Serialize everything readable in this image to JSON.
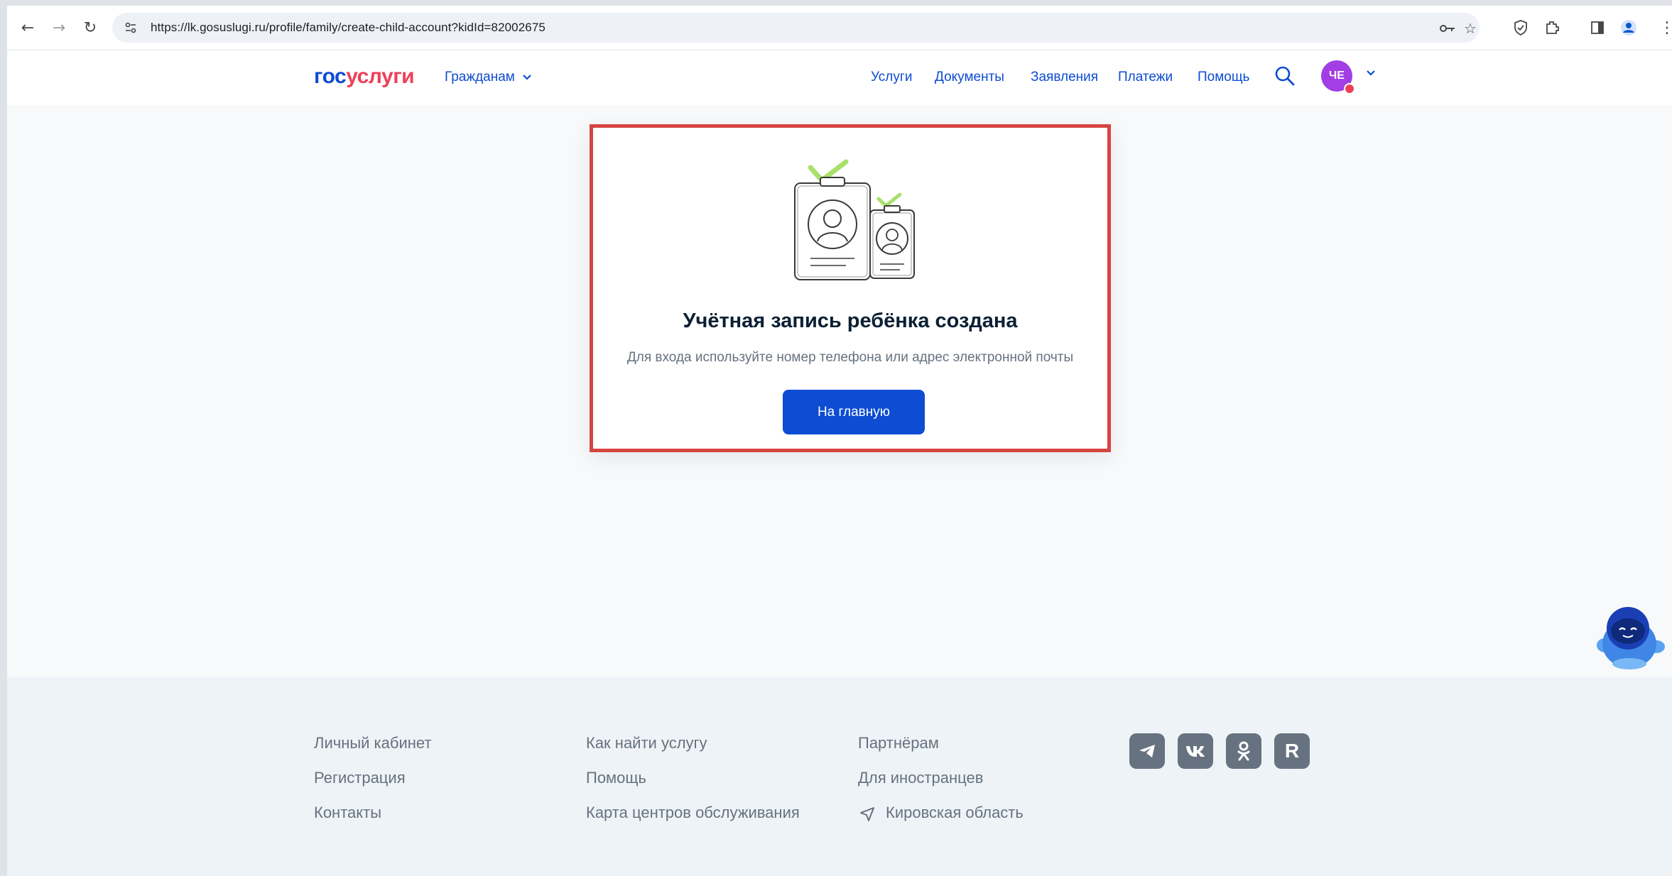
{
  "browser": {
    "url": "https://lk.gosuslugi.ru/profile/family/create-child-account?kidId=82002675",
    "icons": [
      "back-arrow-icon",
      "forward-arrow-icon",
      "reload-icon",
      "site-info-icon",
      "key-icon",
      "star-icon",
      "shield-icon",
      "extensions-icon",
      "sidepanel-icon",
      "profile-icon",
      "menu-icon"
    ]
  },
  "header": {
    "logo_part1": "гос",
    "logo_part2": "услуги",
    "citizens_label": "Гражданам",
    "nav": [
      "Услуги",
      "Документы",
      "Заявления",
      "Платежи",
      "Помощь"
    ],
    "avatar_initials": "ЧЕ"
  },
  "card": {
    "title": "Учётная запись ребёнка создана",
    "subtitle": "Для входа используйте номер телефона или адрес электронной почты",
    "button_label": "На главную",
    "highlight_color": "#d64541"
  },
  "footer": {
    "col1": [
      "Личный кабинет",
      "Регистрация",
      "Контакты"
    ],
    "col2": [
      "Как найти услугу",
      "Помощь",
      "Карта центров обслуживания"
    ],
    "col3": [
      "Партнёрам",
      "Для иностранцев",
      "Кировская область"
    ],
    "social": [
      {
        "name": "telegram-icon",
        "glyph": "➤"
      },
      {
        "name": "vk-icon",
        "glyph": "vk"
      },
      {
        "name": "odnoklassniki-icon",
        "glyph": "ok"
      },
      {
        "name": "rutube-icon",
        "glyph": "R"
      }
    ]
  },
  "colors": {
    "brand_blue": "#0d4cd3",
    "brand_red": "#ee3f58",
    "text_dark": "#0b1f33",
    "text_muted": "#66727f"
  }
}
